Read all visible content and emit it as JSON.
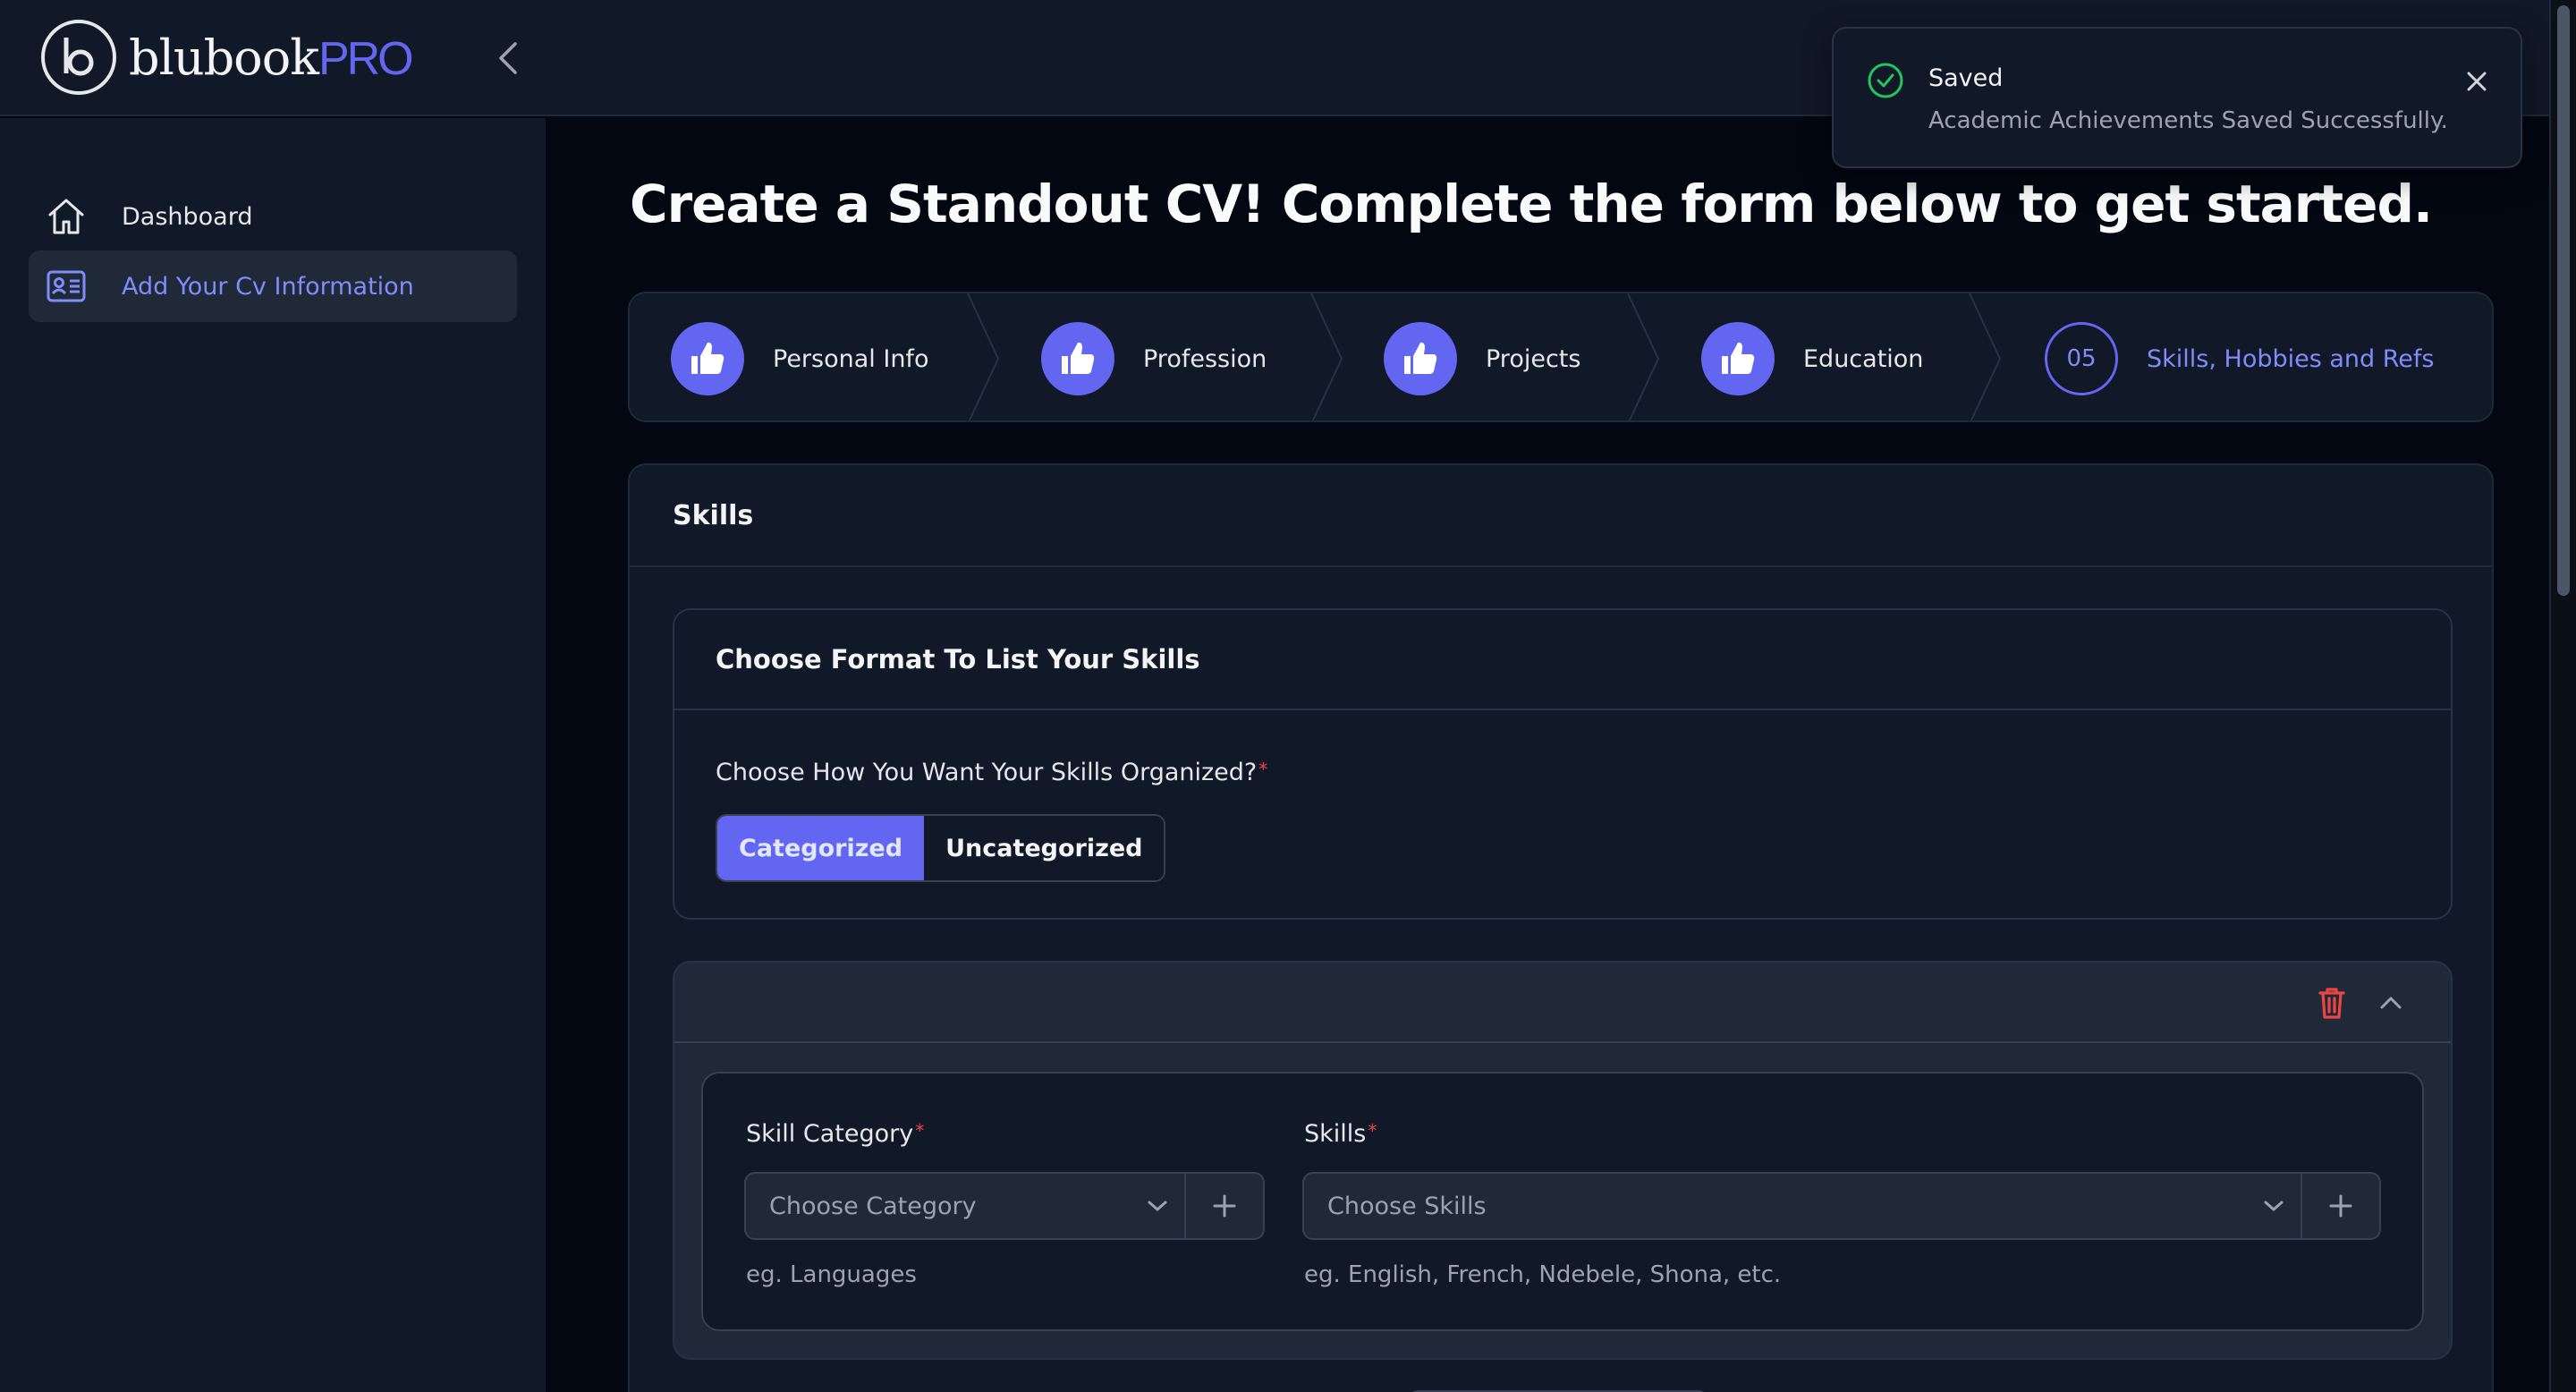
{
  "app": {
    "logo_main": "blubook",
    "logo_pro": "PRO"
  },
  "sidebar": {
    "items": [
      {
        "label": "Dashboard",
        "icon": "home-icon"
      },
      {
        "label": "Add Your Cv Information",
        "icon": "id-card-icon"
      }
    ]
  },
  "main": {
    "title": "Create a Standout CV! Complete the form below to get started.",
    "steps": [
      {
        "label": "Personal Info",
        "icon": "thumbs-up-icon"
      },
      {
        "label": "Profession",
        "icon": "thumbs-up-icon"
      },
      {
        "label": "Projects",
        "icon": "thumbs-up-icon"
      },
      {
        "label": "Education",
        "icon": "thumbs-up-icon"
      },
      {
        "label": "Skills, Hobbies and Refs",
        "number": "05"
      }
    ],
    "skills": {
      "title": "Skills",
      "format": {
        "title": "Choose Format To List Your Skills",
        "question": "Choose How You Want Your Skills Organized?",
        "required_mark": "*",
        "options": [
          "Categorized",
          "Uncategorized"
        ],
        "selected": "Categorized"
      },
      "group": {
        "category_label": "Skill Category",
        "category_placeholder": "Choose Category",
        "category_hint": "eg. Languages",
        "skills_label": "Skills",
        "skills_placeholder": "Choose Skills",
        "skills_hint": "eg. English, French, Ndebele, Shona, etc."
      }
    }
  },
  "toast": {
    "title": "Saved",
    "message": "Academic Achievements Saved Successfully."
  },
  "colors": {
    "accent": "#6366f1",
    "accent_text": "#818cf8",
    "success": "#22c55e",
    "danger": "#ef4444",
    "background": "#030712",
    "surface": "#111827"
  }
}
